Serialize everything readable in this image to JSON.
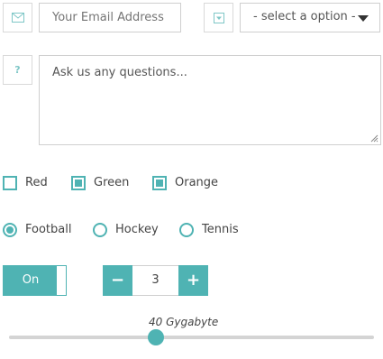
{
  "email": {
    "placeholder": "Your Email Address",
    "icon": "envelope-icon"
  },
  "select": {
    "selected": "- select a option -",
    "icon": "dropdown-icon"
  },
  "question": {
    "icon_label": "?",
    "placeholder": "Ask us any questions..."
  },
  "checkboxes": [
    {
      "label": "Red",
      "checked": false
    },
    {
      "label": "Green",
      "checked": true
    },
    {
      "label": "Orange",
      "checked": true
    }
  ],
  "radios": [
    {
      "label": "Football",
      "selected": true
    },
    {
      "label": "Hockey",
      "selected": false
    },
    {
      "label": "Tennis",
      "selected": false
    }
  ],
  "toggle": {
    "label": "On",
    "state": true
  },
  "stepper": {
    "minus": "−",
    "value": "3",
    "plus": "+"
  },
  "slider": {
    "label": "40 Gygabyte",
    "value": 40,
    "min": 0,
    "max": 100
  },
  "colors": {
    "accent": "#4fb3b3",
    "border": "#cfcfcf",
    "track": "#d4d4d4"
  }
}
